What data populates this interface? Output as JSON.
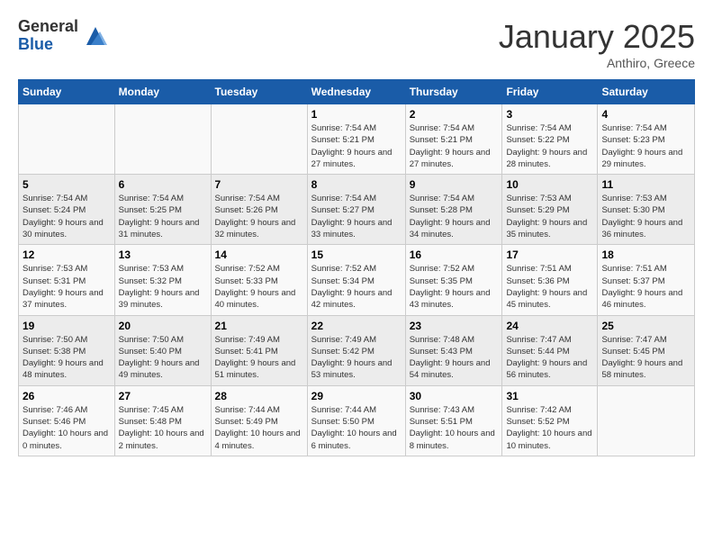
{
  "logo": {
    "general": "General",
    "blue": "Blue"
  },
  "title": "January 2025",
  "location": "Anthiro, Greece",
  "days_of_week": [
    "Sunday",
    "Monday",
    "Tuesday",
    "Wednesday",
    "Thursday",
    "Friday",
    "Saturday"
  ],
  "weeks": [
    [
      {
        "day": "",
        "info": ""
      },
      {
        "day": "",
        "info": ""
      },
      {
        "day": "",
        "info": ""
      },
      {
        "day": "1",
        "info": "Sunrise: 7:54 AM\nSunset: 5:21 PM\nDaylight: 9 hours and 27 minutes."
      },
      {
        "day": "2",
        "info": "Sunrise: 7:54 AM\nSunset: 5:21 PM\nDaylight: 9 hours and 27 minutes."
      },
      {
        "day": "3",
        "info": "Sunrise: 7:54 AM\nSunset: 5:22 PM\nDaylight: 9 hours and 28 minutes."
      },
      {
        "day": "4",
        "info": "Sunrise: 7:54 AM\nSunset: 5:23 PM\nDaylight: 9 hours and 29 minutes."
      }
    ],
    [
      {
        "day": "5",
        "info": "Sunrise: 7:54 AM\nSunset: 5:24 PM\nDaylight: 9 hours and 30 minutes."
      },
      {
        "day": "6",
        "info": "Sunrise: 7:54 AM\nSunset: 5:25 PM\nDaylight: 9 hours and 31 minutes."
      },
      {
        "day": "7",
        "info": "Sunrise: 7:54 AM\nSunset: 5:26 PM\nDaylight: 9 hours and 32 minutes."
      },
      {
        "day": "8",
        "info": "Sunrise: 7:54 AM\nSunset: 5:27 PM\nDaylight: 9 hours and 33 minutes."
      },
      {
        "day": "9",
        "info": "Sunrise: 7:54 AM\nSunset: 5:28 PM\nDaylight: 9 hours and 34 minutes."
      },
      {
        "day": "10",
        "info": "Sunrise: 7:53 AM\nSunset: 5:29 PM\nDaylight: 9 hours and 35 minutes."
      },
      {
        "day": "11",
        "info": "Sunrise: 7:53 AM\nSunset: 5:30 PM\nDaylight: 9 hours and 36 minutes."
      }
    ],
    [
      {
        "day": "12",
        "info": "Sunrise: 7:53 AM\nSunset: 5:31 PM\nDaylight: 9 hours and 37 minutes."
      },
      {
        "day": "13",
        "info": "Sunrise: 7:53 AM\nSunset: 5:32 PM\nDaylight: 9 hours and 39 minutes."
      },
      {
        "day": "14",
        "info": "Sunrise: 7:52 AM\nSunset: 5:33 PM\nDaylight: 9 hours and 40 minutes."
      },
      {
        "day": "15",
        "info": "Sunrise: 7:52 AM\nSunset: 5:34 PM\nDaylight: 9 hours and 42 minutes."
      },
      {
        "day": "16",
        "info": "Sunrise: 7:52 AM\nSunset: 5:35 PM\nDaylight: 9 hours and 43 minutes."
      },
      {
        "day": "17",
        "info": "Sunrise: 7:51 AM\nSunset: 5:36 PM\nDaylight: 9 hours and 45 minutes."
      },
      {
        "day": "18",
        "info": "Sunrise: 7:51 AM\nSunset: 5:37 PM\nDaylight: 9 hours and 46 minutes."
      }
    ],
    [
      {
        "day": "19",
        "info": "Sunrise: 7:50 AM\nSunset: 5:38 PM\nDaylight: 9 hours and 48 minutes."
      },
      {
        "day": "20",
        "info": "Sunrise: 7:50 AM\nSunset: 5:40 PM\nDaylight: 9 hours and 49 minutes."
      },
      {
        "day": "21",
        "info": "Sunrise: 7:49 AM\nSunset: 5:41 PM\nDaylight: 9 hours and 51 minutes."
      },
      {
        "day": "22",
        "info": "Sunrise: 7:49 AM\nSunset: 5:42 PM\nDaylight: 9 hours and 53 minutes."
      },
      {
        "day": "23",
        "info": "Sunrise: 7:48 AM\nSunset: 5:43 PM\nDaylight: 9 hours and 54 minutes."
      },
      {
        "day": "24",
        "info": "Sunrise: 7:47 AM\nSunset: 5:44 PM\nDaylight: 9 hours and 56 minutes."
      },
      {
        "day": "25",
        "info": "Sunrise: 7:47 AM\nSunset: 5:45 PM\nDaylight: 9 hours and 58 minutes."
      }
    ],
    [
      {
        "day": "26",
        "info": "Sunrise: 7:46 AM\nSunset: 5:46 PM\nDaylight: 10 hours and 0 minutes."
      },
      {
        "day": "27",
        "info": "Sunrise: 7:45 AM\nSunset: 5:48 PM\nDaylight: 10 hours and 2 minutes."
      },
      {
        "day": "28",
        "info": "Sunrise: 7:44 AM\nSunset: 5:49 PM\nDaylight: 10 hours and 4 minutes."
      },
      {
        "day": "29",
        "info": "Sunrise: 7:44 AM\nSunset: 5:50 PM\nDaylight: 10 hours and 6 minutes."
      },
      {
        "day": "30",
        "info": "Sunrise: 7:43 AM\nSunset: 5:51 PM\nDaylight: 10 hours and 8 minutes."
      },
      {
        "day": "31",
        "info": "Sunrise: 7:42 AM\nSunset: 5:52 PM\nDaylight: 10 hours and 10 minutes."
      },
      {
        "day": "",
        "info": ""
      }
    ]
  ]
}
